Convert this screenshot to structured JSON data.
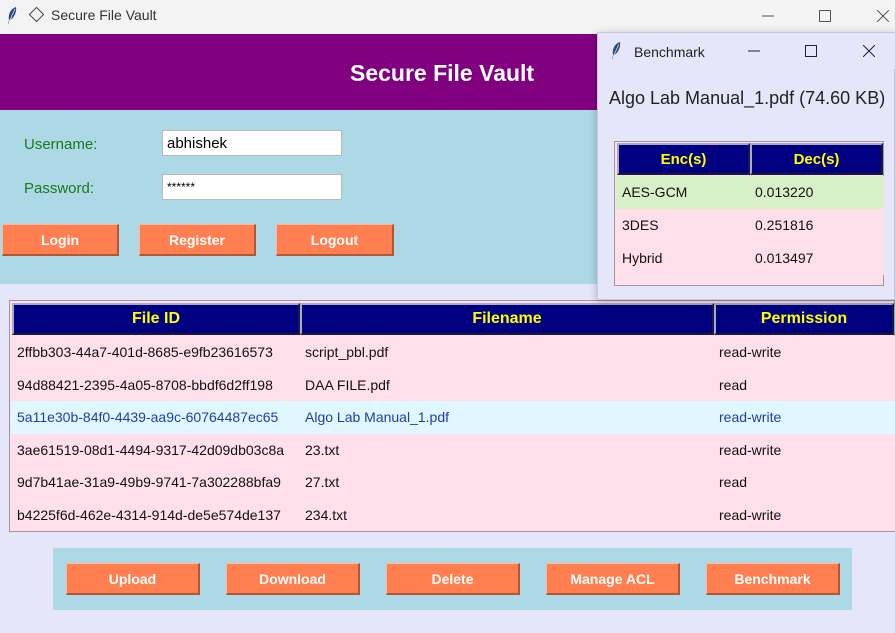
{
  "window": {
    "title": "Secure File Vault"
  },
  "header": {
    "title": "Secure File Vault"
  },
  "login": {
    "username_label": "Username:",
    "password_label": "Password:",
    "username_value": "abhishek",
    "password_value": "******",
    "buttons": {
      "login": "Login",
      "register": "Register",
      "logout": "Logout"
    }
  },
  "files": {
    "columns": [
      "File ID",
      "Filename",
      "Permission"
    ],
    "rows": [
      {
        "id": "2ffbb303-44a7-401d-8685-e9fb23616573",
        "filename": "script_pbl.pdf",
        "permission": "read-write"
      },
      {
        "id": "94d88421-2395-4a05-8708-bbdf6d2ff198",
        "filename": "DAA FILE.pdf",
        "permission": "read"
      },
      {
        "id": "5a11e30b-84f0-4439-aa9c-60764487ec65",
        "filename": "Algo Lab Manual_1.pdf",
        "permission": "read-write"
      },
      {
        "id": "3ae61519-08d1-4494-9317-42d09db03c8a",
        "filename": "23.txt",
        "permission": "read-write"
      },
      {
        "id": "9d7b41ae-31a9-49b9-9741-7a302288bfa9",
        "filename": "27.txt",
        "permission": "read"
      },
      {
        "id": "b4225f6d-462e-4314-914d-de5e574de137",
        "filename": "234.txt",
        "permission": "read-write"
      }
    ],
    "selected_index": 2
  },
  "actions": {
    "upload": "Upload",
    "download": "Download",
    "delete": "Delete",
    "manage_acl": "Manage ACL",
    "benchmark": "Benchmark"
  },
  "benchmark": {
    "title": "Benchmark",
    "file_label": "Algo Lab Manual_1.pdf (74.60 KB)",
    "columns": [
      "Enc(s)",
      "Dec(s)"
    ],
    "rows": [
      {
        "algorithm": "AES-GCM",
        "value": "0.013220"
      },
      {
        "algorithm": "3DES",
        "value": "0.251816"
      },
      {
        "algorithm": "Hybrid",
        "value": "0.013497"
      }
    ]
  },
  "colors": {
    "header": "#800080",
    "panel": "#add8e6",
    "button": "#ff7f50",
    "table_header": "#000080",
    "table_header_text": "#ffff00",
    "row": "#ffe0ea",
    "selected_row": "#e0f7ff",
    "best_row": "#d8f0c8",
    "background": "#e6e6fa"
  },
  "icons": {
    "app": "feather-icon",
    "window": "diamond-icon",
    "minimize": "minimize-icon",
    "maximize": "maximize-icon",
    "close": "close-icon"
  }
}
